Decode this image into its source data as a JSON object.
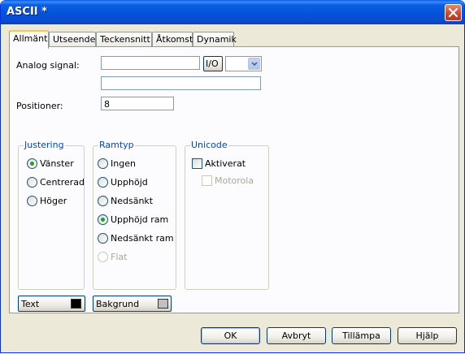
{
  "window": {
    "title": "ASCII *"
  },
  "tabs": [
    {
      "label": "Allmänt",
      "active": true
    },
    {
      "label": "Utseende"
    },
    {
      "label": "Teckensnitt"
    },
    {
      "label": "Åtkomst"
    },
    {
      "label": "Dynamik"
    }
  ],
  "general": {
    "analog_signal_label": "Analog signal:",
    "analog_signal_value": "",
    "io_button": "I/O",
    "combo_value": "",
    "second_field_value": "",
    "positions_label": "Positioner:",
    "positions_value": "8"
  },
  "justering": {
    "title": "Justering",
    "options": [
      {
        "label": "Vänster",
        "checked": true
      },
      {
        "label": "Centrerad",
        "checked": false
      },
      {
        "label": "Höger",
        "checked": false
      }
    ]
  },
  "ramtyp": {
    "title": "Ramtyp",
    "options": [
      {
        "label": "Ingen",
        "checked": false
      },
      {
        "label": "Upphöjd",
        "checked": false
      },
      {
        "label": "Nedsänkt",
        "checked": false
      },
      {
        "label": "Upphöjd ram",
        "checked": true
      },
      {
        "label": "Nedsänkt ram",
        "checked": false
      },
      {
        "label": "Flat",
        "checked": false,
        "disabled": true
      }
    ]
  },
  "unicode": {
    "title": "Unicode",
    "aktiverat": {
      "label": "Aktiverat",
      "checked": false
    },
    "motorola": {
      "label": "Motorola",
      "checked": false,
      "disabled": true
    }
  },
  "colors": {
    "text_label": "Text",
    "text_color": "#000000",
    "background_label": "Bakgrund",
    "background_color": "#c0c0c0"
  },
  "buttons": {
    "ok": "OK",
    "cancel": "Avbryt",
    "apply": "Tillämpa",
    "help": "Hjälp"
  }
}
